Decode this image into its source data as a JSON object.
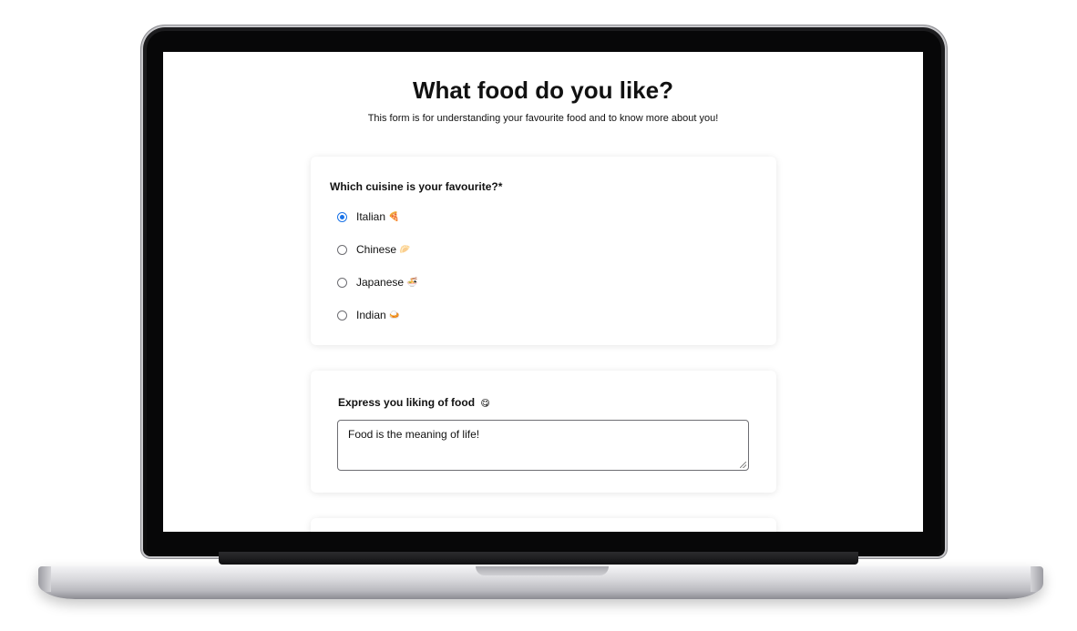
{
  "form": {
    "title": "What food do you like?",
    "description": "This form is for understanding your favourite food and to know more about you!"
  },
  "cuisine_question": {
    "label": "Which cuisine is your favourite?*",
    "selected": "Italian",
    "options": [
      {
        "label": "Italian",
        "emoji": "🍕",
        "icon": "pizza-icon",
        "checked": true
      },
      {
        "label": "Chinese",
        "emoji": "🥟",
        "icon": "dumpling-icon",
        "checked": false
      },
      {
        "label": "Japanese",
        "emoji": "🍜",
        "icon": "ramen-icon",
        "checked": false
      },
      {
        "label": "Indian",
        "emoji": "🍛",
        "icon": "curry-icon",
        "checked": false
      }
    ]
  },
  "liking_question": {
    "label": "Express you liking of food",
    "emoji": "😋",
    "value": "Food is the meaning of life!"
  },
  "colors": {
    "accent": "#1a73e8",
    "text": "#111111",
    "card_background": "#ffffff"
  }
}
